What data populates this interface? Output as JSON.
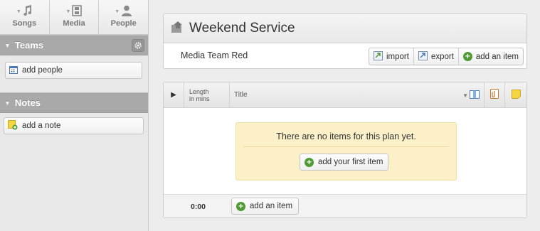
{
  "sidebar": {
    "tabs": [
      {
        "label": "Songs",
        "icon": "music-note-icon"
      },
      {
        "label": "Media",
        "icon": "film-icon"
      },
      {
        "label": "People",
        "icon": "person-icon"
      }
    ],
    "teams": {
      "title": "Teams",
      "add_label": "add people"
    },
    "notes": {
      "title": "Notes",
      "add_label": "add a note"
    }
  },
  "plan": {
    "title": "Weekend Service",
    "team_name": "Media Team Red",
    "actions": {
      "import": "import",
      "export": "export",
      "add_item": "add an item"
    }
  },
  "items": {
    "headers": {
      "length_line1": "Length",
      "length_line2": "in mins",
      "title": "Title"
    },
    "empty_message": "There are no items for this plan yet.",
    "add_first_label": "add your first item",
    "total_length": "0:00",
    "add_item_label": "add an item"
  },
  "colors": {
    "accent_green": "#4f9a33",
    "empty_bg": "#fcf0c9",
    "section_header": "#a9a9a9"
  }
}
